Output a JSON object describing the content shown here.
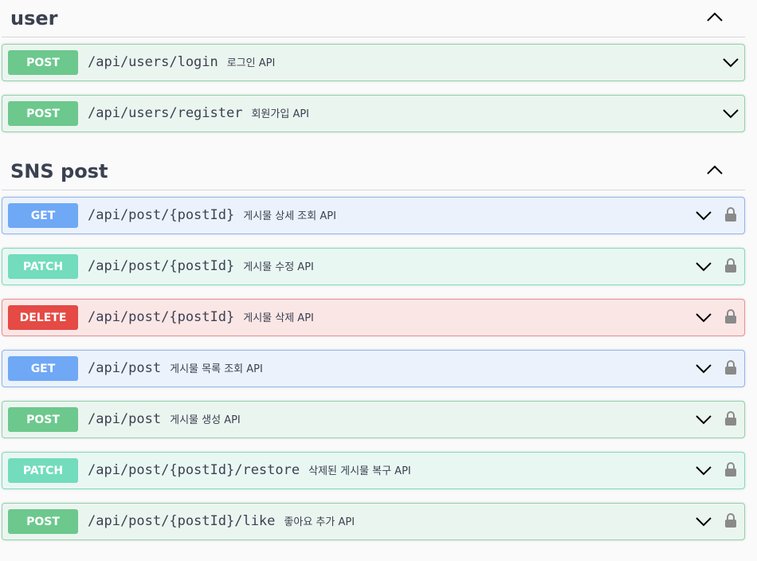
{
  "sections": [
    {
      "title": "user",
      "operations": [
        {
          "method": "POST",
          "path": "/api/users/login",
          "summary": "로그인 API"
        },
        {
          "method": "POST",
          "path": "/api/users/register",
          "summary": "회원가입 API"
        }
      ]
    },
    {
      "title": "SNS post",
      "operations": [
        {
          "method": "GET",
          "path": "/api/post/{postId}",
          "summary": "게시물 상세 조회 API"
        },
        {
          "method": "PATCH",
          "path": "/api/post/{postId}",
          "summary": "게시물 수정 API"
        },
        {
          "method": "DELETE",
          "path": "/api/post/{postId}",
          "summary": "게시물 삭제 API"
        },
        {
          "method": "GET",
          "path": "/api/post",
          "summary": "게시물 목록 조회 API"
        },
        {
          "method": "POST",
          "path": "/api/post",
          "summary": "게시물 생성 API"
        },
        {
          "method": "PATCH",
          "path": "/api/post/{postId}/restore",
          "summary": "삭제된 게시물 복구 API"
        },
        {
          "method": "POST",
          "path": "/api/post/{postId}/like",
          "summary": "좋아요 추가 API"
        }
      ]
    }
  ],
  "icons": {
    "section_toggle": "chevron-up-icon",
    "op_expand": "chevron-down-icon",
    "auth": "lock-icon"
  },
  "colors": {
    "post": "#6cc88d",
    "get": "#6fa8f5",
    "patch": "#73dcbc",
    "delete": "#e54a45"
  }
}
